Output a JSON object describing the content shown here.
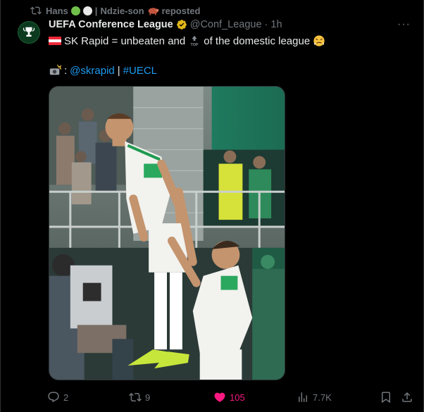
{
  "repost": {
    "user": "Hans",
    "separator": "|",
    "second_user": "Ndzie-son",
    "suffix": "reposted"
  },
  "tweet": {
    "author_name": "UEFA Conference League",
    "handle": "@Conf_League",
    "dot": "·",
    "time": "1h",
    "more_label": "···",
    "line1_a": "SK Rapid = unbeaten and",
    "line1_b": "of the domestic league",
    "line2_link1": "@skrapid",
    "line2_sep": "|",
    "line2_link2": "#UECL"
  },
  "actions": {
    "replies": "2",
    "reposts": "9",
    "likes": "105",
    "views": "7.7K"
  },
  "colors": {
    "accent": "#1d9bf0",
    "like": "#f91880",
    "muted": "#71767b",
    "verified_gold": "#e2b719"
  },
  "icons": [
    "repost-icon",
    "avatar-logo-icon",
    "verified-icon",
    "more-icon",
    "flag-austria-icon",
    "top-icon",
    "angry-face-icon",
    "camera-flash-icon",
    "reply-icon",
    "repost-icon",
    "heart-icon",
    "views-icon",
    "bookmark-icon",
    "share-icon"
  ]
}
